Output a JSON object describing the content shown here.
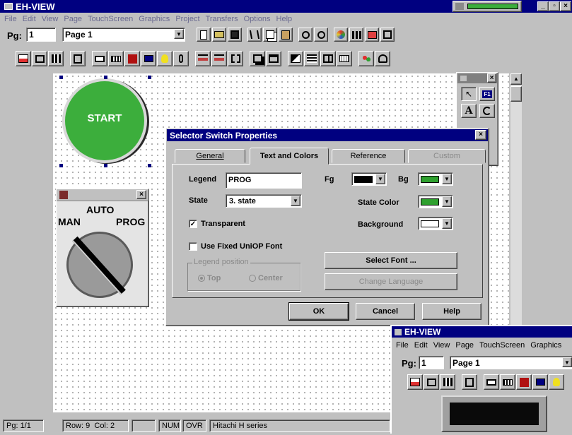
{
  "app": {
    "title": "EH-VIEW"
  },
  "menu": [
    "File",
    "Edit",
    "View",
    "Page",
    "TouchScreen",
    "Graphics",
    "Project",
    "Transfers",
    "Options",
    "Help"
  ],
  "page_selector": {
    "label": "Pg:",
    "number": "1",
    "name": "Page 1"
  },
  "canvas_objects": {
    "start_button": {
      "label": "START"
    },
    "selector_switch": {
      "left_label": "MAN",
      "top_label": "AUTO",
      "right_label": "PROG"
    }
  },
  "toolbox": {
    "f1_label": "F1",
    "text_tool": "A"
  },
  "dialog": {
    "title": "Selector Switch Properties",
    "tabs": [
      {
        "label": "General",
        "active": false,
        "enabled": true
      },
      {
        "label": "Text and Colors",
        "active": true,
        "enabled": true
      },
      {
        "label": "Reference",
        "active": false,
        "enabled": true
      },
      {
        "label": "Custom",
        "active": false,
        "enabled": false
      }
    ],
    "legend_label": "Legend",
    "legend_value": "PROG",
    "state_label": "State",
    "state_value": "3. state",
    "fg_label": "Fg",
    "bg_label": "Bg",
    "state_color_label": "State Color",
    "background_label": "Background",
    "transparent_label": "Transparent",
    "transparent_checked": true,
    "fixed_font_label": "Use Fixed UniOP Font",
    "fixed_font_checked": false,
    "legend_position_label": "Legend position",
    "pos_top": "Top",
    "pos_center": "Center",
    "select_font": "Select Font ...",
    "change_language": "Change Language",
    "ok": "OK",
    "cancel": "Cancel",
    "help": "Help",
    "colors": {
      "fg": "#000000",
      "bg": "#2ea02e",
      "state_color": "#2ea02e",
      "background": "#ffffff"
    }
  },
  "status": {
    "page": "Pg: 1/1",
    "row": "Row: 9",
    "col": "Col: 2",
    "num": "NUM",
    "ovr": "OVR",
    "series": "Hitachi H series"
  },
  "inset": {
    "title": "EH-VIEW",
    "menu": [
      "File",
      "Edit",
      "View",
      "Page",
      "TouchScreen",
      "Graphics"
    ],
    "page_label": "Pg:",
    "page_number": "1",
    "page_name": "Page 1"
  },
  "colors": {
    "title_bar": "#000080",
    "accent_green": "#3cae3c",
    "canvas": "#ffffff"
  }
}
